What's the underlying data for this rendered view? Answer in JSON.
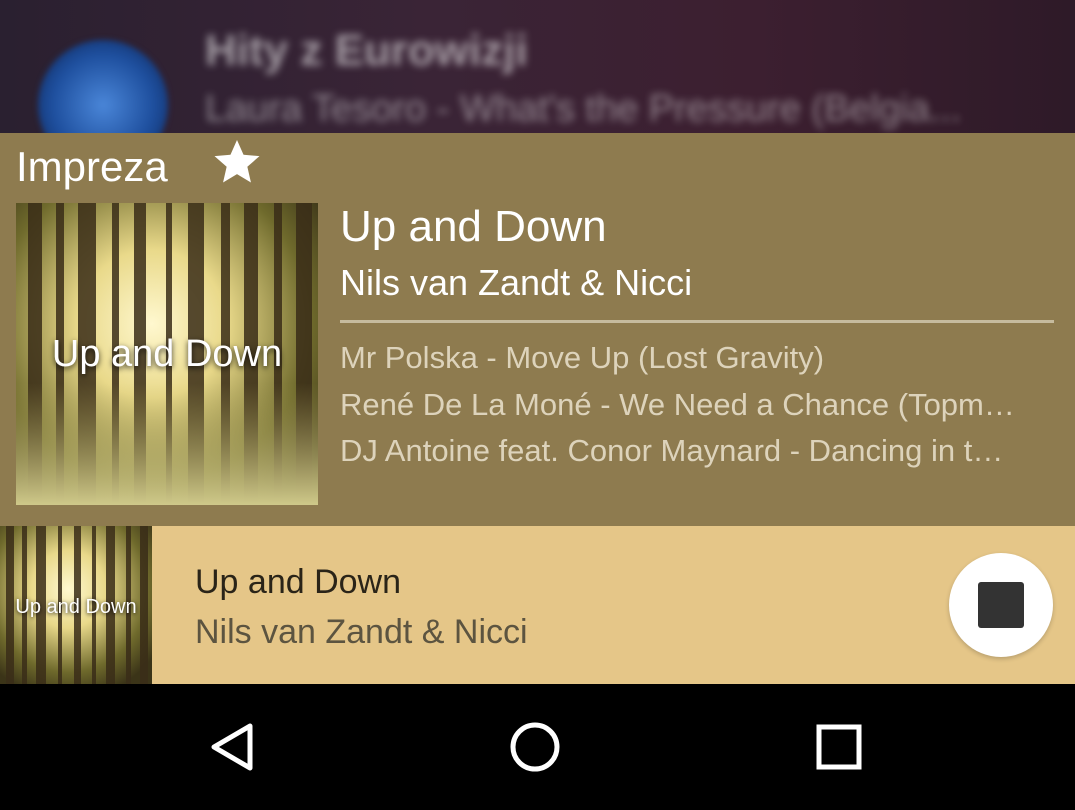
{
  "background_notification": {
    "title": "Hity z Eurowizji",
    "subtitle": "Laura Tesoro - What's the Pressure (Belgia..."
  },
  "card": {
    "playlist_name": "Impreza",
    "favorite_icon": "star-icon",
    "album_art_text": "Up and Down",
    "now_playing": {
      "title": "Up and Down",
      "artist": "Nils van Zandt & Nicci"
    },
    "queue": [
      "Mr Polska - Move Up (Lost Gravity)",
      "René De La Moné - We Need a Chance (Topm…",
      "DJ Antoine feat. Conor Maynard - Dancing in t…"
    ]
  },
  "mini_player": {
    "album_art_text": "Up and Down",
    "title": "Up and Down",
    "artist": "Nils van Zandt & Nicci",
    "stop_icon": "stop-icon"
  },
  "navbar": {
    "back_icon": "back-icon",
    "home_icon": "home-icon",
    "recents_icon": "recents-icon"
  },
  "colors": {
    "card_background": "#8e7b4f",
    "mini_player_background": "#e5c688",
    "navbar_background": "#000000"
  }
}
